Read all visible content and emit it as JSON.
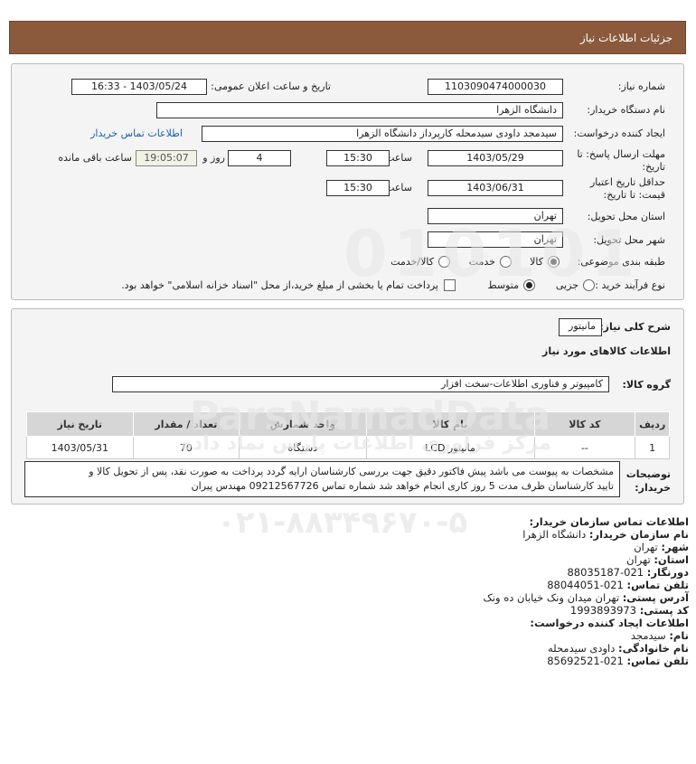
{
  "header": {
    "title": "جزئیات اطلاعات نیاز"
  },
  "form": {
    "need_number_label": "شماره نیاز:",
    "need_number": "1103090474000030",
    "announce_label": "تاریخ و ساعت اعلان عمومی:",
    "announce_value": "1403/05/24 - 16:33",
    "buyer_org_label": "نام دستگاه خریدار:",
    "buyer_org": "دانشگاه الزهرا",
    "creator_label": "ایجاد کننده درخواست:",
    "creator": "سیدمجد داودی سیدمحله کارپرداز دانشگاه الزهرا",
    "contact_link": "اطلاعات تماس خریدار",
    "deadline_label_1": "مهلت ارسال پاسخ: تا",
    "deadline_label_2": "تاریخ:",
    "deadline_date": "1403/05/29",
    "time_label": "ساعت",
    "deadline_time": "15:30",
    "days": "4",
    "days_label": "روز و",
    "remaining_time": "19:05:07",
    "remaining_label": "ساعت باقی مانده",
    "validity_label_1": "حداقل تاریخ اعتبار",
    "validity_label_2": "قیمت: تا تاریخ:",
    "validity_date": "1403/06/31",
    "validity_time": "15:30",
    "province_label": "استان محل تحویل:",
    "province": "تهران",
    "city_label": "شهر محل تحویل:",
    "city": "تهران",
    "category_label": "طبقه بندی موضوعی:",
    "category_options": [
      "کالا",
      "خدمت",
      "کالا/خدمت"
    ],
    "category_selected": "کالا",
    "process_label": "نوع فرآیند خرید :",
    "process_options": [
      "جزیی",
      "متوسط"
    ],
    "process_selected": "متوسط",
    "payment_text": "پرداخت تمام یا بخشی از مبلغ خرید،از محل \"اسناد خزانه اسلامی\" خواهد بود."
  },
  "details": {
    "summary_label": "شرح کلی نیاز:",
    "summary": "مانیتور",
    "goods_info_title": "اطلاعات کالاهای مورد نیاز",
    "group_label": "گروه کالا:",
    "group": "کامپیوتر و فناوری اطلاعات-سخت افزار",
    "columns": [
      "ردیف",
      "کد کالا",
      "نام کالا",
      "واحد شمارش",
      "تعداد / مقدار",
      "تاریخ نیاز"
    ],
    "rows": [
      {
        "row": "1",
        "code": "--",
        "name": "مانیتور LCD",
        "unit": "دستگاه",
        "qty": "70",
        "date": "1403/05/31"
      }
    ],
    "buyer_notes_label_1": "توضیحات",
    "buyer_notes_label_2": "خریدار:",
    "buyer_notes_line1": "مشخصات به پیوست می باشد پیش فاکتور دقیق جهت بررسی کارشناسان ارایه گردد پرداخت به صورت نقد، پس از تحویل کالا و",
    "buyer_notes_line2": "تایید کارشناسان ظرف مدت 5 روز کاری انجام خواهد شد شماره تماس 09212567726 مهندس پیران"
  },
  "contact": {
    "title": "اطلاعات تماس سازمان خریدار:",
    "org_label": "نام سازمان خریدار:",
    "org": "دانشگاه الزهرا",
    "city_label": "شهر:",
    "city": "تهران",
    "province_label": "استان:",
    "province": "تهران",
    "fax_label": "دورنگار:",
    "fax": "021-88035187",
    "phone_label": "تلفن تماس:",
    "phone": "021-88044051",
    "address_label": "آدرس پستی:",
    "address": "تهران میدان ونک خیابان ده ونک",
    "postal_label": "کد پستی:",
    "postal": "1993893973",
    "creator_title": "اطلاعات ایجاد کننده درخواست:",
    "name_label": "نام:",
    "name": "سیدمجد",
    "family_label": "نام خانوادگی:",
    "family": "داودی سیدمحله",
    "creator_phone_label": "تلفن تماس:",
    "creator_phone": "021-85692521"
  },
  "watermark": {
    "brand": "ParsNamadData",
    "subtitle": "مرکز فراوری اطلاعات پارس نماد داده",
    "phone": "۰۲۱-۸۸۳۴۹۶۷۰-۵",
    "digits": "010101"
  },
  "colors": {
    "header_bg": "#8b5a3c",
    "link": "#1a5fb4",
    "panel_bg": "#f4f4f4"
  }
}
